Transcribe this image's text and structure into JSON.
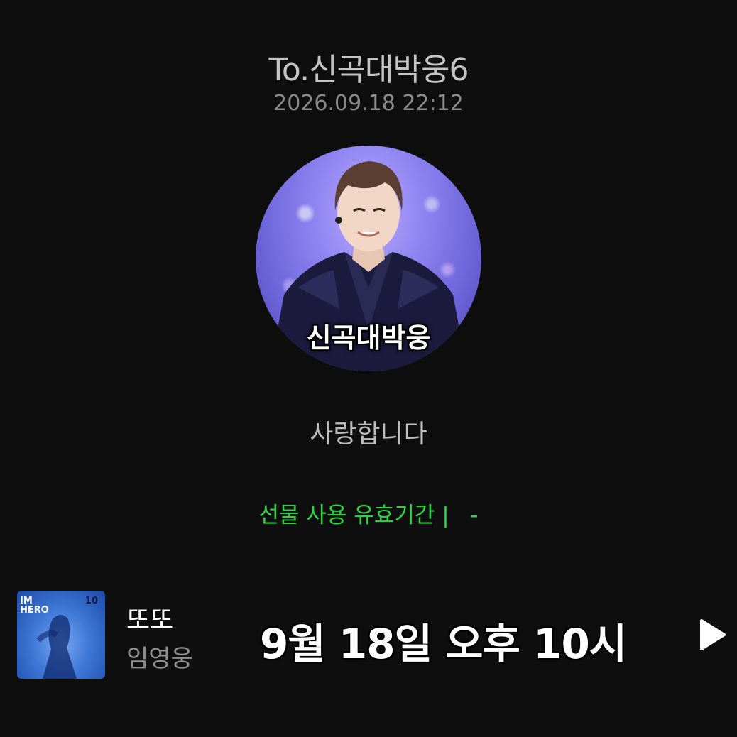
{
  "header": {
    "recipient": "To.신곡대박웅6",
    "timestamp": "2026.09.18 22:12"
  },
  "avatar": {
    "caption": "신곡대박웅"
  },
  "message": "사랑합니다",
  "validity": "선물 사용 유효기간 |   -",
  "song": {
    "title": "또또",
    "artist": "임영웅",
    "cover_text": "IM HERO"
  },
  "overlay": {
    "text": "9월 18일 오후 10시"
  },
  "icons": {
    "play": "play-icon"
  },
  "colors": {
    "background": "#0e0e0e",
    "validity": "#2fd240"
  }
}
